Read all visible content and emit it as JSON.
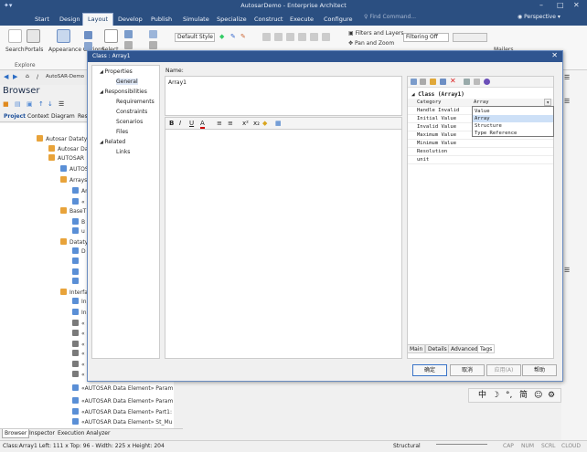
{
  "app_title": "AutosarDemo - Enterprise Architect",
  "window_controls": [
    "–",
    "□",
    "✕"
  ],
  "menu": [
    "Start",
    "Design",
    "Layout",
    "Develop",
    "Publish",
    "Simulate",
    "Specialize",
    "Construct",
    "Execute",
    "Configure"
  ],
  "search_placeholder": "Find Command...",
  "perspective": "Perspective",
  "ribbon": {
    "search": "Search",
    "portals": "Portals",
    "explore": "Explore",
    "appearance": "Appearance Options",
    "select": "Select",
    "style_combo": "Default Style",
    "filters_layers": "Filters and Layers",
    "pan_zoom": "Pan and Zoom",
    "filtering": "Filtering Off",
    "ribbon_right": "Mailers"
  },
  "nav_path": "AutoSAR-Demo",
  "browser_title": "Browser",
  "browser_tabs": [
    "Project",
    "Context",
    "Diagram",
    "Res"
  ],
  "tree": [
    {
      "label": "Autosar Datatyp",
      "color": "#e8a33a"
    },
    {
      "label": "Autosar Da",
      "color": "#e8a33a"
    },
    {
      "label": "AUTOSAR",
      "color": "#e8a33a"
    },
    {
      "label": "AUTOS",
      "color": "#5a8fd6"
    },
    {
      "label": "Arrays",
      "color": "#e8a33a"
    },
    {
      "label": "Ar",
      "color": "#5a8fd6"
    },
    {
      "label": "«",
      "color": "#5a8fd6"
    },
    {
      "label": "BaseT",
      "color": "#e8a33a"
    },
    {
      "label": "B",
      "color": "#5a8fd6"
    },
    {
      "label": "u",
      "color": "#5a8fd6"
    },
    {
      "label": "Dataty",
      "color": "#e8a33a"
    },
    {
      "label": "D",
      "color": "#5a8fd6"
    },
    {
      "label": "",
      "color": "#5a8fd6"
    },
    {
      "label": "",
      "color": "#5a8fd6"
    },
    {
      "label": "",
      "color": "#5a8fd6"
    },
    {
      "label": "Interfa",
      "color": "#e8a33a"
    },
    {
      "label": "In",
      "color": "#5a8fd6"
    },
    {
      "label": "In",
      "color": "#5a8fd6"
    },
    {
      "label": "«",
      "color": "#7a7a7a"
    },
    {
      "label": "«",
      "color": "#7a7a7a"
    },
    {
      "label": "«",
      "color": "#7a7a7a"
    },
    {
      "label": "«",
      "color": "#7a7a7a"
    },
    {
      "label": "«",
      "color": "#7a7a7a"
    },
    {
      "label": "«",
      "color": "#7a7a7a"
    },
    {
      "label": "«AUTOSAR Data Element» Param",
      "color": "#5a8fd6"
    },
    {
      "label": "«AUTOSAR Data Element» Param",
      "color": "#5a8fd6"
    },
    {
      "label": "«AUTOSAR Data Element» Part1:",
      "color": "#5a8fd6"
    },
    {
      "label": "«AUTOSAR Data Element» St_Mu",
      "color": "#5a8fd6"
    }
  ],
  "bottom_tabs": [
    "Browser",
    "Inspector",
    "Execution Analyzer"
  ],
  "status": {
    "left": "Class:Array1   Left:   111 x Top:   96 - Width:   225 x Height:   204",
    "mode": "Structural",
    "indicators": [
      "CAP",
      "NUM",
      "SCRL",
      "CLOUD"
    ]
  },
  "ime": [
    "中",
    "☽",
    "°,",
    "简",
    "☺",
    "⚙"
  ],
  "dialog": {
    "title": "Class : Array1",
    "close": "✕",
    "nav": [
      {
        "label": "Properties",
        "level": 0,
        "toggle": "▲"
      },
      {
        "label": "General",
        "level": 1,
        "selected": true
      },
      {
        "label": "Responsibilities",
        "level": 0,
        "toggle": "▲"
      },
      {
        "label": "Requirements",
        "level": 1
      },
      {
        "label": "Constraints",
        "level": 1
      },
      {
        "label": "Scenarios",
        "level": 1
      },
      {
        "label": "Files",
        "level": 1
      },
      {
        "label": "Related",
        "level": 0,
        "toggle": "▲"
      },
      {
        "label": "Links",
        "level": 1
      }
    ],
    "name_label": "Name:",
    "name_value": "Array1",
    "rt_toolbar": [
      "B",
      "I",
      "U",
      "A",
      "≡",
      "≡",
      "x²",
      "x₂",
      "◆",
      "▦"
    ],
    "props_header": "Class (Array1)",
    "props": [
      {
        "key": "Category",
        "value": "Array"
      },
      {
        "key": "Handle Invalid",
        "value": ""
      },
      {
        "key": "Initial Value",
        "value": ""
      },
      {
        "key": "Invalid Value",
        "value": ""
      },
      {
        "key": "Maximum Value",
        "value": ""
      },
      {
        "key": "Minimum Value",
        "value": ""
      },
      {
        "key": "Resolution",
        "value": ""
      },
      {
        "key": "unit",
        "value": ""
      }
    ],
    "dropdown_options": [
      "Value",
      "Array",
      "Structure",
      "Type Reference"
    ],
    "dropdown_selected": "Array",
    "prop_tabs": [
      "Main",
      "Details",
      "Advanced",
      "Tags"
    ],
    "buttons": {
      "ok": "确定",
      "cancel": "取消",
      "apply": "应用(A)",
      "help": "帮助"
    }
  }
}
